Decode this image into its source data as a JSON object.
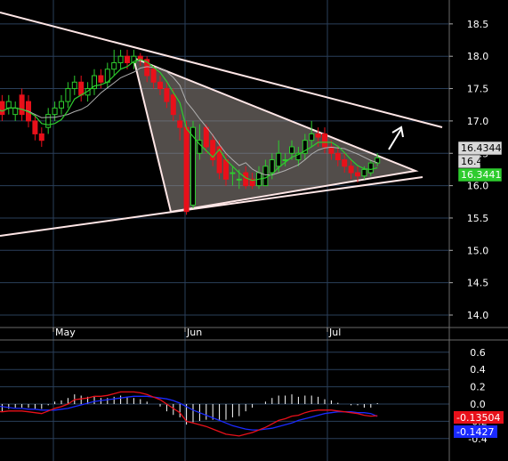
{
  "chart_data": [
    {
      "type": "candlestick",
      "title": "",
      "x_ticks": [
        "May",
        "Jun",
        "Jul"
      ],
      "y_ticks": [
        14.0,
        14.5,
        15.0,
        15.5,
        16.0,
        16.5,
        17.0,
        17.5,
        18.0,
        18.5
      ],
      "ylim": [
        13.8,
        18.85
      ],
      "grid": true,
      "candles": {
        "open": [
          17.5,
          17.3,
          17.2,
          17.1,
          17.4,
          17.3,
          17.0,
          16.8,
          16.9,
          17.1,
          17.2,
          17.3,
          17.5,
          17.6,
          17.4,
          17.5,
          17.7,
          17.6,
          17.8,
          17.9,
          18.0,
          17.9,
          18.0,
          17.95,
          17.8,
          17.6,
          17.5,
          17.4,
          17.0,
          16.9,
          15.7,
          16.5,
          16.9,
          16.7,
          16.6,
          16.4,
          16.2,
          16.1,
          16.2,
          16.1,
          16.0,
          16.0,
          16.2,
          16.3,
          16.4,
          16.5,
          16.4,
          16.5,
          16.7,
          16.8,
          16.8,
          16.6,
          16.5,
          16.4,
          16.3,
          16.2,
          16.15,
          16.2,
          16.35
        ],
        "close": [
          17.2,
          17.1,
          17.3,
          17.2,
          17.1,
          17.0,
          16.8,
          16.7,
          17.1,
          17.2,
          17.3,
          17.5,
          17.6,
          17.4,
          17.5,
          17.7,
          17.6,
          17.8,
          17.9,
          18.0,
          17.9,
          18.0,
          17.95,
          17.7,
          17.6,
          17.5,
          17.3,
          17.1,
          16.9,
          15.6,
          16.9,
          16.7,
          16.6,
          16.4,
          16.2,
          16.1,
          16.2,
          16.1,
          16.0,
          16.0,
          16.2,
          16.3,
          16.4,
          16.5,
          16.4,
          16.6,
          16.5,
          16.7,
          16.8,
          16.75,
          16.6,
          16.5,
          16.4,
          16.3,
          16.2,
          16.15,
          16.25,
          16.35,
          16.43
        ],
        "high": [
          17.6,
          17.4,
          17.4,
          17.3,
          17.5,
          17.4,
          17.1,
          16.9,
          17.2,
          17.3,
          17.4,
          17.6,
          17.7,
          17.7,
          17.6,
          17.8,
          17.8,
          17.9,
          18.1,
          18.1,
          18.1,
          18.1,
          18.05,
          18.0,
          17.85,
          17.7,
          17.6,
          17.5,
          17.1,
          17.0,
          17.0,
          16.95,
          16.95,
          16.8,
          16.7,
          16.5,
          16.3,
          16.25,
          16.3,
          16.2,
          16.3,
          16.4,
          16.5,
          16.7,
          16.5,
          16.7,
          16.6,
          16.8,
          17.0,
          16.9,
          16.9,
          16.7,
          16.6,
          16.5,
          16.4,
          16.3,
          16.3,
          16.4,
          16.5
        ],
        "low": [
          17.1,
          17.0,
          17.1,
          17.0,
          17.0,
          16.9,
          16.7,
          16.6,
          16.8,
          17.0,
          17.1,
          17.2,
          17.4,
          17.3,
          17.3,
          17.4,
          17.5,
          17.5,
          17.7,
          17.8,
          17.8,
          17.8,
          17.85,
          17.6,
          17.5,
          17.4,
          17.2,
          17.0,
          16.7,
          15.55,
          15.65,
          16.4,
          16.5,
          16.3,
          16.1,
          16.0,
          16.0,
          15.95,
          15.95,
          15.95,
          15.95,
          16.0,
          16.1,
          16.2,
          16.3,
          16.4,
          16.3,
          16.4,
          16.6,
          16.6,
          16.5,
          16.4,
          16.3,
          16.2,
          16.1,
          16.05,
          16.1,
          16.15,
          16.3
        ]
      },
      "overlays": [
        {
          "name": "moving-average-green",
          "color": "#2ecc2e"
        },
        {
          "name": "moving-average-grey",
          "color": "#b0b0b0"
        }
      ],
      "trendlines_color": "#ffe6e6",
      "price_tags": [
        {
          "text": "16.4344",
          "bg": "#d8d8d8",
          "fg": "#000000"
        },
        {
          "text": "16.4",
          "bg": "#d8d8d8",
          "fg": "#000000"
        },
        {
          "text": "16.3441",
          "bg": "#2ecc2e",
          "fg": "#ffffff"
        }
      ],
      "colors": {
        "up": "#2ecc2e",
        "down": "#e8101a",
        "grid": "#2a3f5a",
        "background": "#000000"
      }
    },
    {
      "type": "macd",
      "y_ticks": [
        0.6,
        0.4,
        0.2,
        0.0,
        -0.2,
        -0.4
      ],
      "ylim": [
        -0.48,
        0.66
      ],
      "macd": [
        -0.08,
        -0.09,
        -0.08,
        -0.08,
        -0.08,
        -0.09,
        -0.1,
        -0.11,
        -0.08,
        -0.05,
        -0.03,
        0.0,
        0.05,
        0.06,
        0.07,
        0.09,
        0.09,
        0.1,
        0.12,
        0.14,
        0.14,
        0.14,
        0.13,
        0.11,
        0.08,
        0.05,
        0.0,
        -0.05,
        -0.1,
        -0.2,
        -0.22,
        -0.24,
        -0.26,
        -0.29,
        -0.32,
        -0.35,
        -0.36,
        -0.37,
        -0.35,
        -0.33,
        -0.3,
        -0.27,
        -0.23,
        -0.19,
        -0.17,
        -0.14,
        -0.13,
        -0.1,
        -0.08,
        -0.07,
        -0.07,
        -0.07,
        -0.08,
        -0.09,
        -0.1,
        -0.11,
        -0.13,
        -0.14,
        -0.13504
      ],
      "signal": [
        -0.02,
        -0.03,
        -0.04,
        -0.05,
        -0.05,
        -0.06,
        -0.06,
        -0.07,
        -0.07,
        -0.07,
        -0.06,
        -0.05,
        -0.03,
        -0.01,
        0.01,
        0.03,
        0.04,
        0.05,
        0.06,
        0.07,
        0.08,
        0.09,
        0.09,
        0.09,
        0.08,
        0.07,
        0.06,
        0.04,
        0.01,
        -0.03,
        -0.07,
        -0.1,
        -0.13,
        -0.16,
        -0.19,
        -0.22,
        -0.25,
        -0.27,
        -0.29,
        -0.3,
        -0.3,
        -0.29,
        -0.28,
        -0.26,
        -0.24,
        -0.22,
        -0.19,
        -0.17,
        -0.15,
        -0.13,
        -0.11,
        -0.1,
        -0.09,
        -0.09,
        -0.09,
        -0.1,
        -0.1,
        -0.11,
        -0.1427
      ],
      "colors": {
        "macd": "#e8101a",
        "signal": "#1a2aff",
        "histogram": "#ffffff"
      },
      "value_tags": [
        {
          "text": "-0.13504",
          "bg": "#e8101a",
          "fg": "#ffffff"
        },
        {
          "text": "-0.1427",
          "bg": "#1a2aff",
          "fg": "#ffffff"
        }
      ]
    }
  ]
}
